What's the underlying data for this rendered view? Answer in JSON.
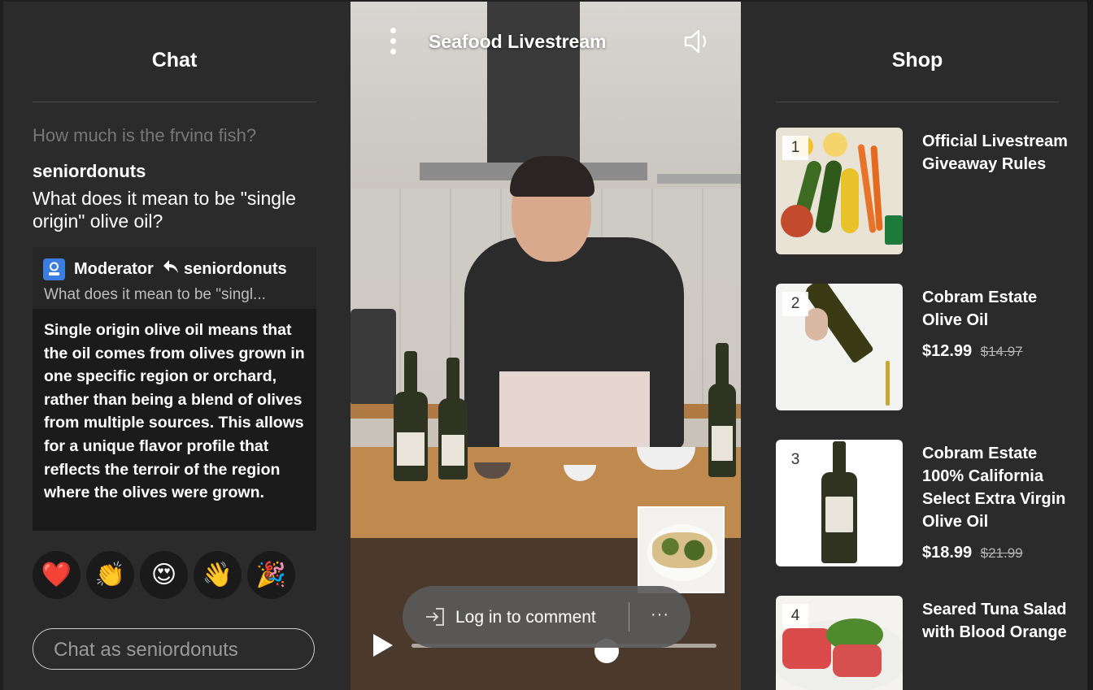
{
  "chat": {
    "title": "Chat",
    "faded_message": "How much is the frying fish?",
    "message_user": "seniordonuts",
    "message_text": "What does it mean to be \"single origin\" olive oil?",
    "moderator": {
      "name": "Moderator",
      "reply_to": "seniordonuts",
      "quoted": "What does it mean to be \"singl...",
      "answer": "Single origin olive oil means that the oil comes from olives grown in one specific region or orchard, rather than being a blend of olives from multiple sources. This allows for a unique flavor profile that reflects the terroir of the region where the olives were grown."
    },
    "reactions": [
      "❤️",
      "👏",
      "😍",
      "👋",
      "🎉"
    ],
    "input_placeholder": "Chat as seniordonuts"
  },
  "video": {
    "title": "Seafood Livestream",
    "login_label": "Log in to comment",
    "more_label": "···",
    "progress_fraction": 0.64,
    "icons": [
      "more-vertical-icon",
      "speaker-icon",
      "login-icon",
      "play-icon"
    ]
  },
  "shop": {
    "title": "Shop",
    "products": [
      {
        "num": "1",
        "name": "Official Livestream Giveaway Rules",
        "price": "",
        "old_price": ""
      },
      {
        "num": "2",
        "name": "Cobram Estate Olive Oil",
        "price": "$12.99",
        "old_price": "$14.97"
      },
      {
        "num": "3",
        "name": "Cobram Estate 100% California Select Extra Virgin Olive Oil",
        "price": "$18.99",
        "old_price": "$21.99"
      },
      {
        "num": "4",
        "name": "Seared Tuna Salad with Blood Orange",
        "price": "",
        "old_price": ""
      }
    ]
  }
}
